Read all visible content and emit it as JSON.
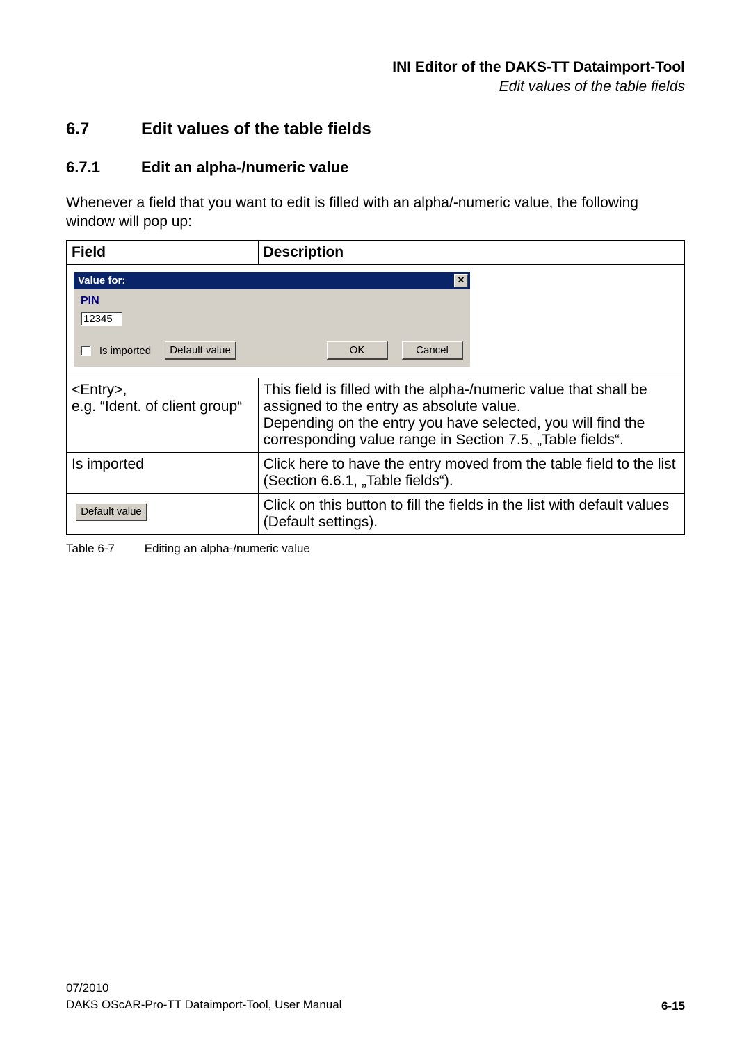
{
  "header": {
    "title": "INI Editor of the DAKS-TT Dataimport-Tool",
    "subtitle": "Edit values of the table fields"
  },
  "section": {
    "number": "6.7",
    "title": "Edit values of the table fields"
  },
  "subsection": {
    "number": "6.7.1",
    "title": "Edit an alpha-/numeric value"
  },
  "intro": "Whenever a field that you want to edit is filled with an alpha/-numeric value, the following window will pop up:",
  "table": {
    "headers": {
      "field": "Field",
      "description": "Description"
    },
    "dialog": {
      "title": "Value for:",
      "field_label": "PIN",
      "input_value": "12345",
      "checkbox_label": "Is imported",
      "default_btn": "Default value",
      "ok_btn": "OK",
      "cancel_btn": "Cancel"
    },
    "rows": [
      {
        "field": "<Entry>,\ne.g. “Ident. of client group“",
        "description": "This field is filled with the alpha-/numeric value that shall be assigned to the entry as absolute value.\nDepending on the entry you have selected, you will find the corresponding value range in Section 7.5, „Table fields“."
      },
      {
        "field": "Is imported",
        "description": "Click here to have the entry moved from the table field to the list (Section 6.6.1, „Table fields“)."
      },
      {
        "field_button": "Default value",
        "description": "Click on this button to fill the fields in the list with default values (Default settings)."
      }
    ],
    "caption_number": "Table 6-7",
    "caption_text": "Editing an alpha-/numeric value"
  },
  "footer": {
    "date": "07/2010",
    "doc": "DAKS OScAR-Pro-TT Dataimport-Tool, User Manual",
    "page": "6-15"
  }
}
